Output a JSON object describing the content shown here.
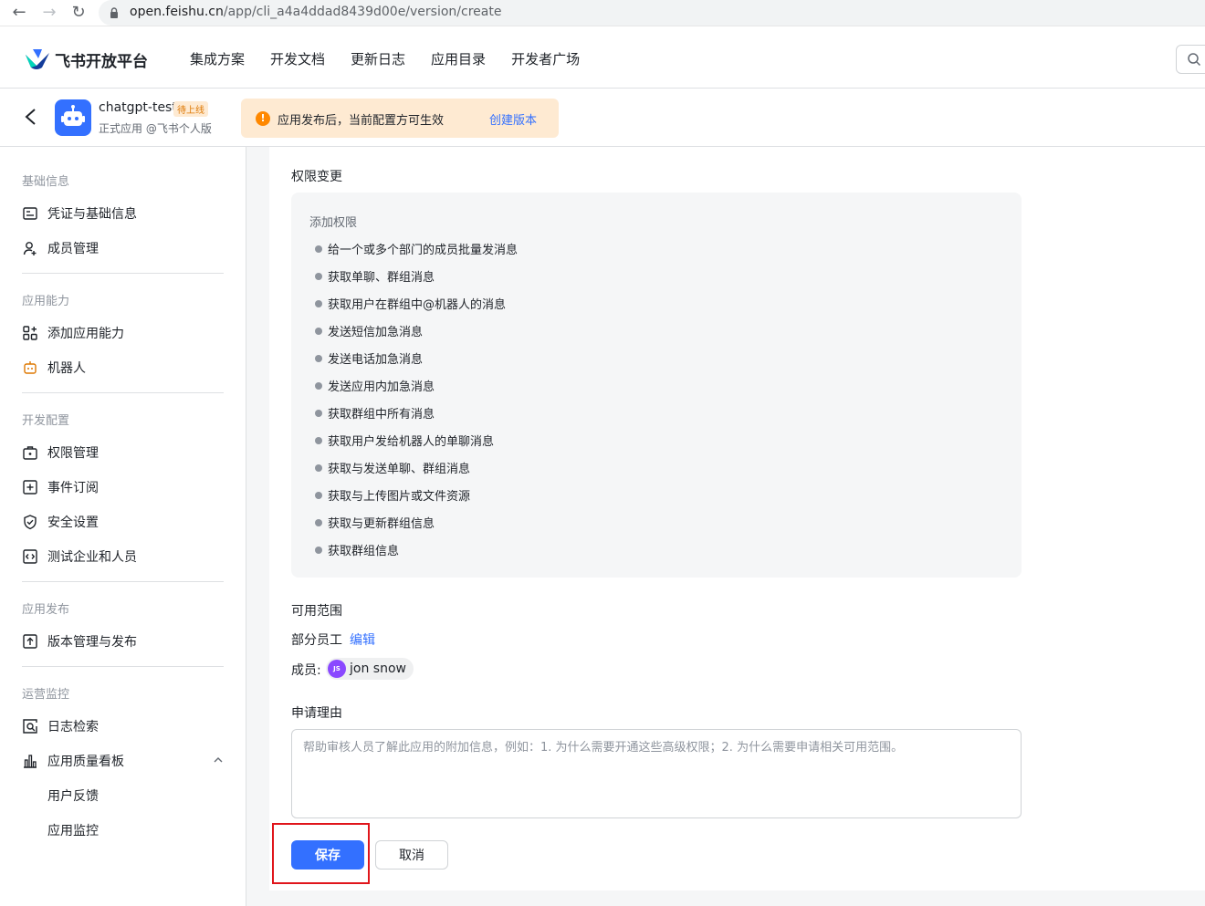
{
  "browser": {
    "url_host": "open.feishu.cn",
    "url_path": "/app/cli_a4a4ddad8439d00e/version/create",
    "back_glyph": "←",
    "forward_glyph": "→",
    "reload_glyph": "↻"
  },
  "header": {
    "logo_text": "飞书开放平台",
    "nav": [
      "集成方案",
      "开发文档",
      "更新日志",
      "应用目录",
      "开发者广场"
    ]
  },
  "app": {
    "name": "chatgpt-test",
    "status": "待上线",
    "subtitle": "正式应用 @飞书个人版",
    "notice_text": "应用发布后，当前配置方可生效",
    "notice_link": "创建版本",
    "notice_icon": "!"
  },
  "sidebar": {
    "groups": {
      "basic": "基础信息",
      "ability": "应用能力",
      "dev": "开发配置",
      "publish": "应用发布",
      "ops": "运营监控"
    },
    "items": {
      "credentials": "凭证与基础信息",
      "members": "成员管理",
      "add_ability": "添加应用能力",
      "bot": "机器人",
      "permissions": "权限管理",
      "events": "事件订阅",
      "security": "安全设置",
      "test_enterprise": "测试企业和人员",
      "version": "版本管理与发布",
      "log_search": "日志检索",
      "quality": "应用质量看板",
      "feedback": "用户反馈",
      "monitor": "应用监控"
    }
  },
  "main": {
    "perm_title": "权限变更",
    "perm_add_head": "添加权限",
    "permissions": [
      "给一个或多个部门的成员批量发消息",
      "获取单聊、群组消息",
      "获取用户在群组中@机器人的消息",
      "发送短信加急消息",
      "发送电话加急消息",
      "发送应用内加急消息",
      "获取群组中所有消息",
      "获取用户发给机器人的单聊消息",
      "获取与发送单聊、群组消息",
      "获取与上传图片或文件资源",
      "获取与更新群组信息",
      "获取群组信息"
    ],
    "scope_title": "可用范围",
    "scope_value": "部分员工",
    "scope_edit": "编辑",
    "member_label": "成员:",
    "member_initials": "JS",
    "member_name": "jon snow",
    "reason_title": "申请理由",
    "reason_placeholder": "帮助审核人员了解此应用的附加信息，例如：1. 为什么需要开通这些高级权限；2. 为什么需要申请相关可用范围。",
    "save_label": "保存",
    "cancel_label": "取消"
  }
}
